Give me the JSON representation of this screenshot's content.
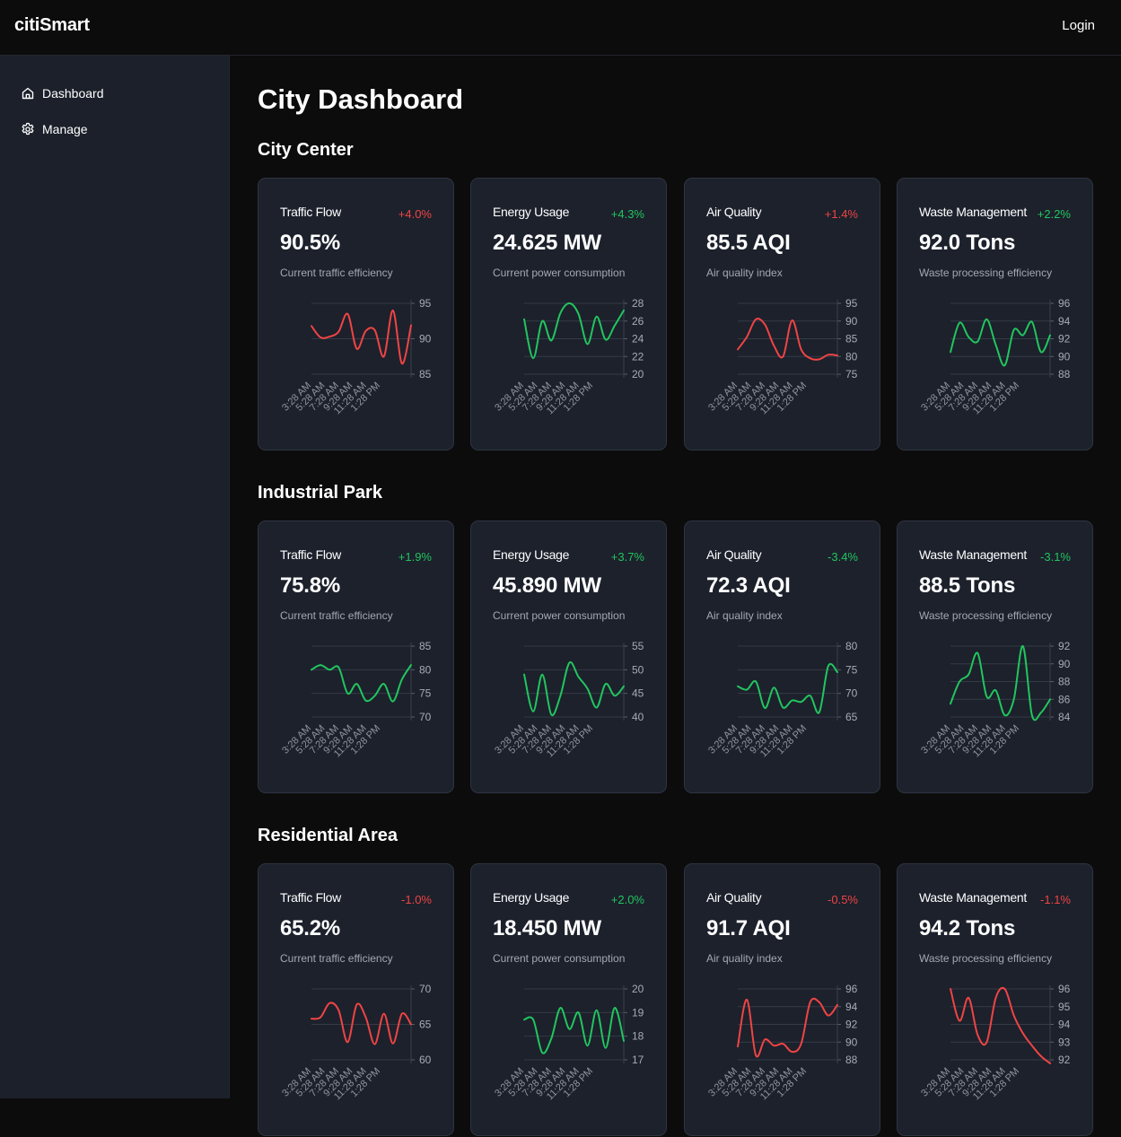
{
  "app": {
    "name": "citiSmart",
    "login_label": "Login"
  },
  "sidebar": {
    "items": [
      {
        "label": "Dashboard",
        "icon": "home-icon"
      },
      {
        "label": "Manage",
        "icon": "gear-icon"
      }
    ]
  },
  "page": {
    "title": "City Dashboard"
  },
  "colors": {
    "up": "#ef4444",
    "good": "#22c55e",
    "line_red": "#ef4444",
    "line_green": "#22c55e"
  },
  "sections": [
    {
      "title": "City Center",
      "cards": [
        {
          "title": "Traffic Flow",
          "change": "+4.0%",
          "change_color": "red",
          "value": "90.5%",
          "description": "Current traffic efficiency"
        },
        {
          "title": "Energy Usage",
          "change": "+4.3%",
          "change_color": "green",
          "value": "24.625 MW",
          "description": "Current power consumption"
        },
        {
          "title": "Air Quality",
          "change": "+1.4%",
          "change_color": "red",
          "value": "85.5 AQI",
          "description": "Air quality index"
        },
        {
          "title": "Waste Management",
          "change": "+2.2%",
          "change_color": "green",
          "value": "92.0 Tons",
          "description": "Waste processing efficiency"
        }
      ]
    },
    {
      "title": "Industrial Park",
      "cards": [
        {
          "title": "Traffic Flow",
          "change": "+1.9%",
          "change_color": "green",
          "value": "75.8%",
          "description": "Current traffic efficiency"
        },
        {
          "title": "Energy Usage",
          "change": "+3.7%",
          "change_color": "green",
          "value": "45.890 MW",
          "description": "Current power consumption"
        },
        {
          "title": "Air Quality",
          "change": "-3.4%",
          "change_color": "green",
          "value": "72.3 AQI",
          "description": "Air quality index"
        },
        {
          "title": "Waste Management",
          "change": "-3.1%",
          "change_color": "green",
          "value": "88.5 Tons",
          "description": "Waste processing efficiency"
        }
      ]
    },
    {
      "title": "Residential Area",
      "cards": [
        {
          "title": "Traffic Flow",
          "change": "-1.0%",
          "change_color": "red",
          "value": "65.2%",
          "description": "Current traffic efficiency"
        },
        {
          "title": "Energy Usage",
          "change": "+2.0%",
          "change_color": "green",
          "value": "18.450 MW",
          "description": "Current power consumption"
        },
        {
          "title": "Air Quality",
          "change": "-0.5%",
          "change_color": "red",
          "value": "91.7 AQI",
          "description": "Air quality index"
        },
        {
          "title": "Waste Management",
          "change": "-1.1%",
          "change_color": "red",
          "value": "94.2 Tons",
          "description": "Waste processing efficiency"
        }
      ]
    }
  ],
  "chart_data": [
    {
      "type": "line",
      "section": "City Center",
      "metric": "Traffic Flow",
      "color": "red",
      "x": [
        "3:28 AM",
        "5:28 AM",
        "7:28 AM",
        "9:28 AM",
        "11:28 AM",
        "1:28 PM"
      ],
      "yticks": [
        85,
        90,
        95
      ],
      "ylim": [
        85,
        95
      ],
      "values": [
        91.8,
        90.2,
        90.3,
        91.0,
        93.5,
        88.6,
        91.1,
        91.2,
        87.5,
        94.0,
        86.5,
        91.9
      ]
    },
    {
      "type": "line",
      "section": "City Center",
      "metric": "Energy Usage",
      "color": "green",
      "x": [
        "3:28 AM",
        "5:28 AM",
        "7:28 AM",
        "9:28 AM",
        "11:28 AM",
        "1:28 PM"
      ],
      "yticks": [
        20,
        22,
        24,
        26,
        28
      ],
      "ylim": [
        20,
        28
      ],
      "values": [
        26.2,
        21.8,
        26.0,
        23.8,
        26.9,
        28.0,
        26.8,
        23.4,
        26.5,
        23.9,
        25.5,
        27.2
      ]
    },
    {
      "type": "line",
      "section": "City Center",
      "metric": "Air Quality",
      "color": "red",
      "x": [
        "3:28 AM",
        "5:28 AM",
        "7:28 AM",
        "9:28 AM",
        "11:28 AM",
        "1:28 PM"
      ],
      "yticks": [
        75,
        80,
        85,
        90,
        95
      ],
      "ylim": [
        75,
        95
      ],
      "values": [
        82,
        85.5,
        90.5,
        89,
        83,
        80,
        90.2,
        82,
        79.5,
        79.2,
        80.5,
        80.3
      ]
    },
    {
      "type": "line",
      "section": "City Center",
      "metric": "Waste Management",
      "color": "green",
      "x": [
        "3:28 AM",
        "5:28 AM",
        "7:28 AM",
        "9:28 AM",
        "11:28 AM",
        "1:28 PM"
      ],
      "yticks": [
        88,
        90,
        92,
        94,
        96
      ],
      "ylim": [
        88,
        96
      ],
      "values": [
        90.5,
        93.8,
        92.2,
        91.7,
        94.2,
        91.3,
        89.0,
        93.0,
        92.4,
        93.9,
        90.5,
        92.4
      ]
    },
    {
      "type": "line",
      "section": "Industrial Park",
      "metric": "Traffic Flow",
      "color": "green",
      "x": [
        "3:28 AM",
        "5:28 AM",
        "7:28 AM",
        "9:28 AM",
        "11:28 AM",
        "1:28 PM"
      ],
      "yticks": [
        70,
        75,
        80,
        85
      ],
      "ylim": [
        70,
        85
      ],
      "values": [
        80.0,
        81.0,
        80.0,
        80.5,
        75.0,
        77.0,
        73.5,
        74.5,
        77.0,
        73.3,
        78.0,
        81.0
      ]
    },
    {
      "type": "line",
      "section": "Industrial Park",
      "metric": "Energy Usage",
      "color": "green",
      "x": [
        "3:28 AM",
        "5:28 AM",
        "7:28 AM",
        "9:28 AM",
        "11:28 AM",
        "1:28 PM"
      ],
      "yticks": [
        40,
        45,
        50,
        55
      ],
      "ylim": [
        40,
        55
      ],
      "values": [
        49,
        41.2,
        49,
        40.5,
        44.5,
        51.5,
        48.5,
        46,
        42,
        47,
        44.5,
        46.5
      ]
    },
    {
      "type": "line",
      "section": "Industrial Park",
      "metric": "Air Quality",
      "color": "green",
      "x": [
        "3:28 AM",
        "5:28 AM",
        "7:28 AM",
        "9:28 AM",
        "11:28 AM",
        "1:28 PM"
      ],
      "yticks": [
        65,
        70,
        75,
        80
      ],
      "ylim": [
        65,
        80
      ],
      "values": [
        71.5,
        70.8,
        72.5,
        66.9,
        71.2,
        67.0,
        68.5,
        68.2,
        69.5,
        66.0,
        75.8,
        74.5
      ]
    },
    {
      "type": "line",
      "section": "Industrial Park",
      "metric": "Waste Management",
      "color": "green",
      "x": [
        "3:28 AM",
        "5:28 AM",
        "7:28 AM",
        "9:28 AM",
        "11:28 AM",
        "1:28 PM"
      ],
      "yticks": [
        84,
        86,
        88,
        90,
        92
      ],
      "ylim": [
        84,
        92
      ],
      "values": [
        85.5,
        88.0,
        88.8,
        91.2,
        86.3,
        87.0,
        84.2,
        86.0,
        92.0,
        84.2,
        84.5,
        86.0
      ]
    },
    {
      "type": "line",
      "section": "Residential Area",
      "metric": "Traffic Flow",
      "color": "red",
      "x": [
        "3:28 AM",
        "5:28 AM",
        "7:28 AM",
        "9:28 AM",
        "11:28 AM",
        "1:28 PM"
      ],
      "yticks": [
        60,
        65,
        70
      ],
      "ylim": [
        60,
        70
      ],
      "values": [
        65.8,
        66.0,
        68.0,
        67.0,
        62.5,
        67.8,
        66.0,
        62.2,
        66.5,
        62.3,
        66.5,
        65.0
      ]
    },
    {
      "type": "line",
      "section": "Residential Area",
      "metric": "Energy Usage",
      "color": "green",
      "x": [
        "3:28 AM",
        "5:28 AM",
        "7:28 AM",
        "9:28 AM",
        "11:28 AM",
        "1:28 PM"
      ],
      "yticks": [
        17,
        18,
        19,
        20
      ],
      "ylim": [
        17,
        20
      ],
      "values": [
        18.7,
        18.7,
        17.3,
        17.9,
        19.2,
        18.3,
        19.0,
        17.6,
        19.1,
        17.5,
        19.2,
        17.8
      ]
    },
    {
      "type": "line",
      "section": "Residential Area",
      "metric": "Air Quality",
      "color": "red",
      "x": [
        "3:28 AM",
        "5:28 AM",
        "7:28 AM",
        "9:28 AM",
        "11:28 AM",
        "1:28 PM"
      ],
      "yticks": [
        88,
        90,
        92,
        94,
        96
      ],
      "ylim": [
        88,
        96
      ],
      "values": [
        89.5,
        94.8,
        88.5,
        90.3,
        89.6,
        89.8,
        88.9,
        89.8,
        94.5,
        94.5,
        93.0,
        94.2
      ]
    },
    {
      "type": "line",
      "section": "Residential Area",
      "metric": "Waste Management",
      "color": "red",
      "x": [
        "3:28 AM",
        "5:28 AM",
        "7:28 AM",
        "9:28 AM",
        "11:28 AM",
        "1:28 PM"
      ],
      "yticks": [
        92,
        93,
        94,
        95,
        96
      ],
      "ylim": [
        92,
        96
      ],
      "values": [
        96.0,
        94.2,
        95.5,
        93.4,
        93.0,
        95.5,
        96.0,
        94.5,
        93.5,
        92.8,
        92.2,
        91.8
      ]
    }
  ]
}
